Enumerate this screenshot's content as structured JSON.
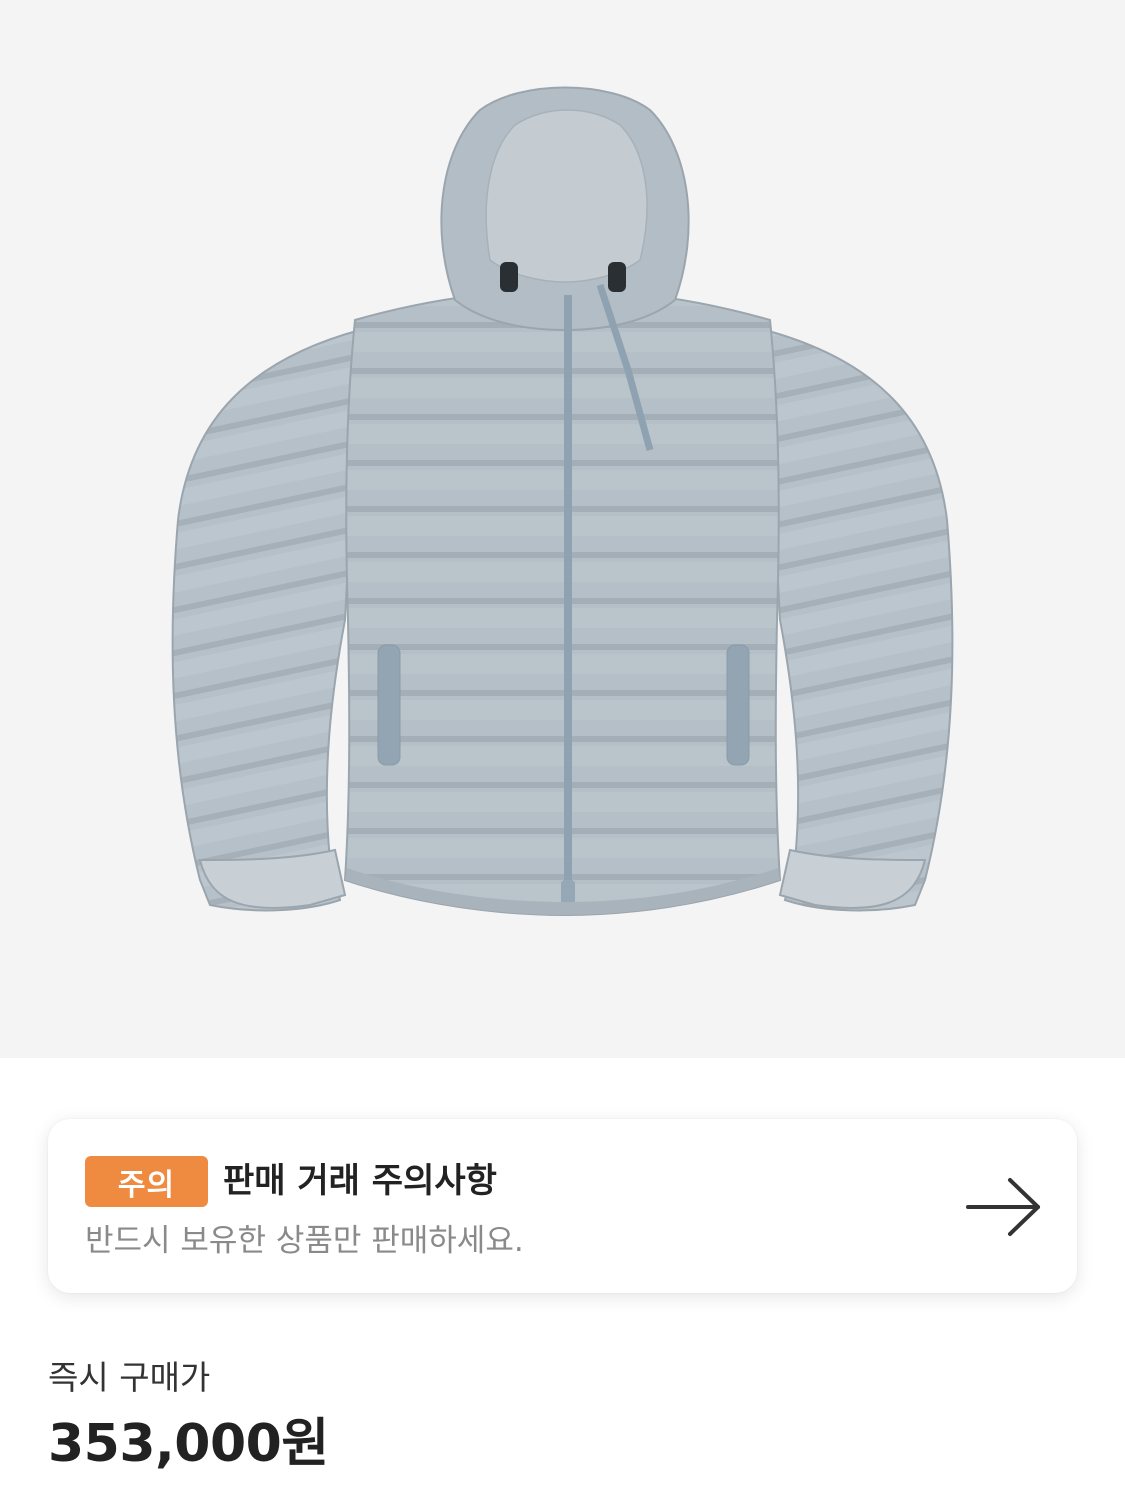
{
  "product": {
    "image_alt": "Light blue hooded puffer down jacket",
    "background_color": "#f4f4f4",
    "jacket_color": "#b3bdc5"
  },
  "notice": {
    "badge": "주의",
    "badge_color": "#ef8b41",
    "title": "판매 거래 주의사항",
    "subtitle": "반드시 보유한 상품만 판매하세요.",
    "arrow_icon": "arrow-right-icon"
  },
  "price": {
    "label": "즉시 구매가",
    "value": "353,000원"
  }
}
